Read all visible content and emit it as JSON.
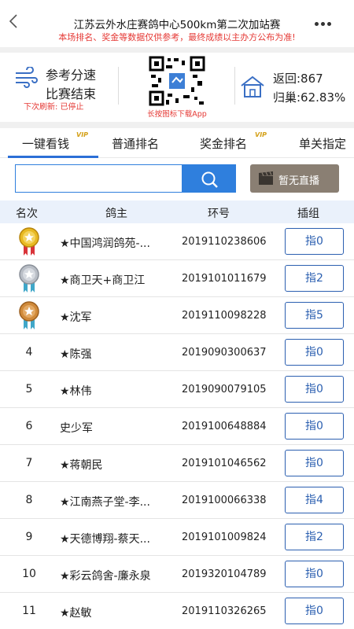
{
  "header": {
    "title": "江苏云外水庄赛鸽中心500km第二次加站赛",
    "subtitle": "本场排名、奖金等数据仅供参考，最终成绩以主办方公布为准!"
  },
  "info": {
    "speed_line1": "参考分速",
    "speed_line2": "比赛结束",
    "refresh": "下次刷新: 已停止",
    "qr_caption": "长按图标下载App",
    "returned": "返回:867",
    "home_rate": "归巢:62.83%"
  },
  "tabs": [
    {
      "label": "一键看钱",
      "vip": "VIP",
      "active": true
    },
    {
      "label": "普通排名"
    },
    {
      "label": "奖金排名",
      "vip": "VIP"
    },
    {
      "label": "单关指定"
    }
  ],
  "search": {
    "placeholder": ""
  },
  "live": {
    "label": "暂无直播"
  },
  "table": {
    "headers": [
      "名次",
      "鸽主",
      "环号",
      "插组"
    ],
    "rows": [
      {
        "rank": "1",
        "medal": "gold",
        "owner": "★中国鸿润鸽苑-...",
        "ring": "2019110238606",
        "group": "指0"
      },
      {
        "rank": "2",
        "medal": "silver",
        "owner": "★商卫天+商卫江",
        "ring": "2019101011679",
        "group": "指2"
      },
      {
        "rank": "3",
        "medal": "bronze",
        "owner": "★沈军",
        "ring": "2019110098228",
        "group": "指5"
      },
      {
        "rank": "4",
        "owner": "★陈强",
        "ring": "2019090300637",
        "group": "指0"
      },
      {
        "rank": "5",
        "owner": "★林伟",
        "ring": "2019090079105",
        "group": "指0"
      },
      {
        "rank": "6",
        "owner": "史少军",
        "ring": "2019100648884",
        "group": "指0"
      },
      {
        "rank": "7",
        "owner": "★蒋朝民",
        "ring": "2019101046562",
        "group": "指0"
      },
      {
        "rank": "8",
        "owner": "★江南燕子堂-李...",
        "ring": "2019100066338",
        "group": "指4"
      },
      {
        "rank": "9",
        "owner": "★天德博翔-蔡天...",
        "ring": "2019101009824",
        "group": "指2"
      },
      {
        "rank": "10",
        "owner": "★彩云鸽舍-廉永泉",
        "ring": "2019320104789",
        "group": "指0"
      },
      {
        "rank": "11",
        "owner": "★赵敏",
        "ring": "2019110326265",
        "group": "指0"
      }
    ]
  },
  "colors": {
    "accent": "#2f7fdd",
    "warning": "#e53935",
    "gold": "#e8b923",
    "silver": "#b9bec6",
    "bronze": "#d08a3a"
  }
}
